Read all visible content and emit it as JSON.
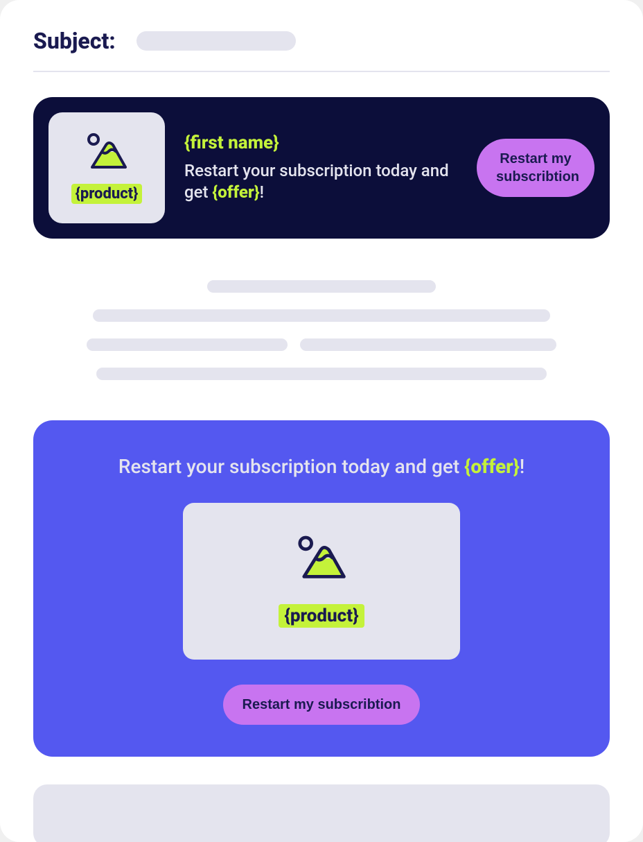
{
  "subject": {
    "label": "Subject:"
  },
  "hero": {
    "product_label": "{product}",
    "first_name": "{first name}",
    "body_before": "Restart your subscription today and get ",
    "offer_label": "{offer}",
    "body_after": "!",
    "button": "Restart my subscribtion"
  },
  "cta": {
    "headline_before": "Restart your subscription today and get ",
    "offer_label": "{offer}",
    "headline_after": "!",
    "product_label": "{product}",
    "button": "Restart my subscribtion"
  },
  "colors": {
    "darkNavy": "#0c0e3a",
    "lime": "#c4f23a",
    "purpleBtn": "#c874f0",
    "blurple": "#5458f0",
    "lightGray": "#e4e4ee",
    "textDark": "#1a1a50"
  }
}
